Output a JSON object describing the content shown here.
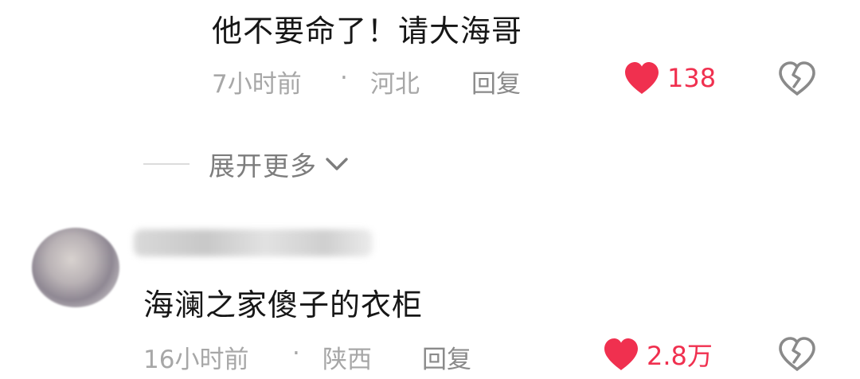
{
  "comments": [
    {
      "text": "他不要命了！请大海哥",
      "time": "7小时前",
      "separator": "·",
      "location": "河北",
      "reply_label": "回复",
      "like_count": "138"
    },
    {
      "text": "海澜之家傻子的衣柜",
      "time": "16小时前",
      "separator": "·",
      "location": "陕西",
      "reply_label": "回复",
      "like_count": "2.8万"
    }
  ],
  "expand": {
    "label": "展开更多"
  },
  "colors": {
    "like": "#f0304f",
    "meta": "#a7a7a7",
    "text": "#161616"
  },
  "icons": [
    "heart-icon",
    "broken-heart-icon",
    "chevron-down-icon"
  ]
}
